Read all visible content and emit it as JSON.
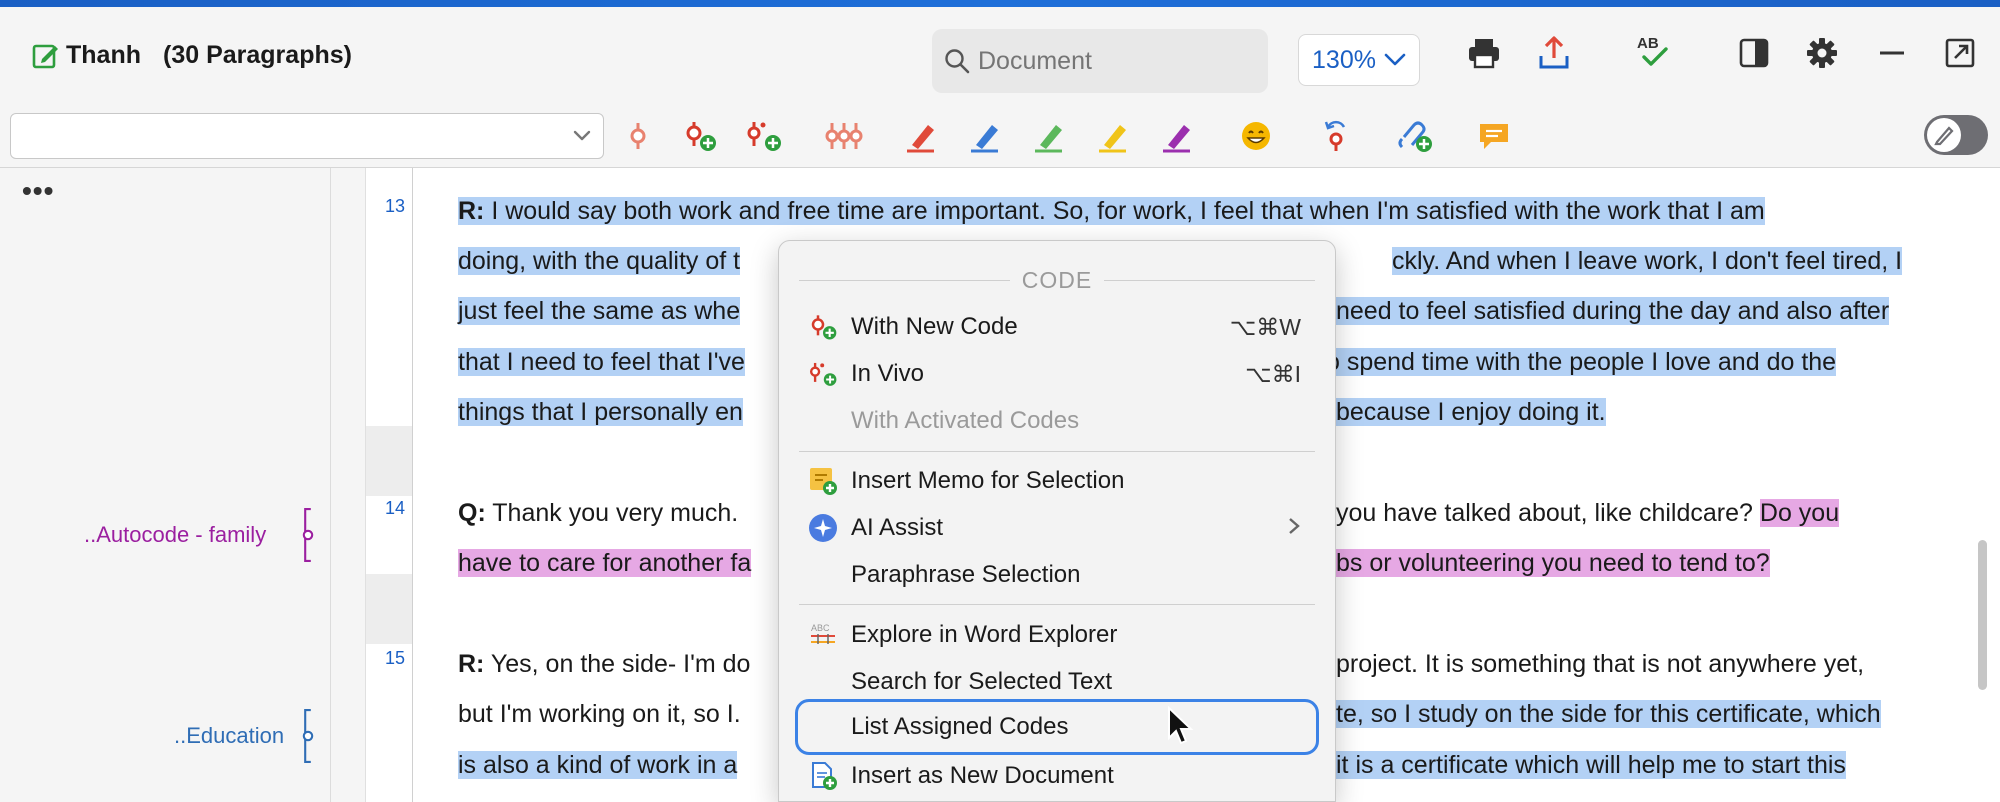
{
  "window": {
    "title": "Thanh",
    "paragraph_count": "(30 Paragraphs)"
  },
  "search": {
    "placeholder": "Document"
  },
  "zoom": {
    "value": "130%"
  },
  "toolbar": {
    "icons": [
      "print-icon",
      "export-icon",
      "spellcheck-icon",
      "sidebar-toggle-icon",
      "settings-icon",
      "minimize-icon",
      "detach-window-icon"
    ]
  },
  "coding_toolbar": {
    "selected_code": "",
    "icons": [
      "code-icon",
      "code-new-icon",
      "invivo-icon",
      "activated-codes-icon",
      "highlighter-red-icon",
      "highlighter-blue-icon",
      "highlighter-green-icon",
      "highlighter-yellow-icon",
      "highlighter-purple-icon",
      "emoji-icon",
      "undo-code-icon",
      "link-add-icon",
      "comment-icon"
    ],
    "colors": {
      "red": "#e04a3a",
      "blue": "#3a7bd5",
      "green": "#5cb85c",
      "yellow": "#f0c419",
      "purple": "#9b2fae",
      "emoji": "#f5b700",
      "comment": "#f5a623"
    }
  },
  "left_pane": {
    "more_label": "•••",
    "codes": [
      {
        "label": "..Autocode - family",
        "color": "#9b1fa0"
      },
      {
        "label": "..Education",
        "color": "#2f6db5"
      }
    ]
  },
  "paragraphs": {
    "numbers": [
      "13",
      "14",
      "15"
    ],
    "p13": {
      "speaker": "R:",
      "line1": " I would say both work and free time are important. So, for work, I feel that when I'm satisfied with the work that I am",
      "line2": "doing, with the quality of t",
      "line2b": "ckly. And when I leave work, I don't feel tired, I",
      "line3": "just feel the same as whe",
      "line3b": "need to feel satisfied during the day and also after",
      "line4": "that I need to feel that I've",
      "line4b": "o spend time with the people I love and do the",
      "line5": "things that I personally en",
      "line5b": " because I enjoy doing it."
    },
    "p14": {
      "speaker": "Q:",
      "line1": " Thank you very much.",
      "line1b": "you have talked about, like childcare?",
      "line1c": "Do you",
      "line2": "have to care for another fa",
      "line2b": "bs or volunteering you need to tend to?"
    },
    "p15": {
      "speaker": "R:",
      "line1": " Yes, on the side- I'm do",
      "line1b": " project. It is something that is not anywhere yet,",
      "line2": "but I'm working on it, so I.",
      "line2b": "te, so I study on the side for this certificate, which",
      "line3": "is also a kind of work in a",
      "line3b": "it is a certificate which will help me to start this"
    }
  },
  "context_menu": {
    "header": "CODE",
    "items": [
      {
        "label": "With New Code",
        "shortcut": "⌥⌘W",
        "icon": "code-new-icon"
      },
      {
        "label": "In Vivo",
        "shortcut": "⌥⌘I",
        "icon": "invivo-icon"
      },
      {
        "label": "With Activated Codes",
        "shortcut": "",
        "icon": ""
      },
      {
        "label": "Insert Memo for Selection",
        "shortcut": "",
        "icon": "memo-add-icon"
      },
      {
        "label": "AI Assist",
        "shortcut": "",
        "icon": "ai-assist-icon"
      },
      {
        "label": "Paraphrase Selection",
        "shortcut": "",
        "icon": ""
      },
      {
        "label": "Explore in Word Explorer",
        "shortcut": "",
        "icon": "word-explorer-icon"
      },
      {
        "label": "Search for Selected Text",
        "shortcut": "",
        "icon": ""
      },
      {
        "label": "List Assigned Codes",
        "shortcut": "",
        "icon": ""
      },
      {
        "label": "Insert as New Document",
        "shortcut": "",
        "icon": "new-document-icon"
      }
    ]
  }
}
